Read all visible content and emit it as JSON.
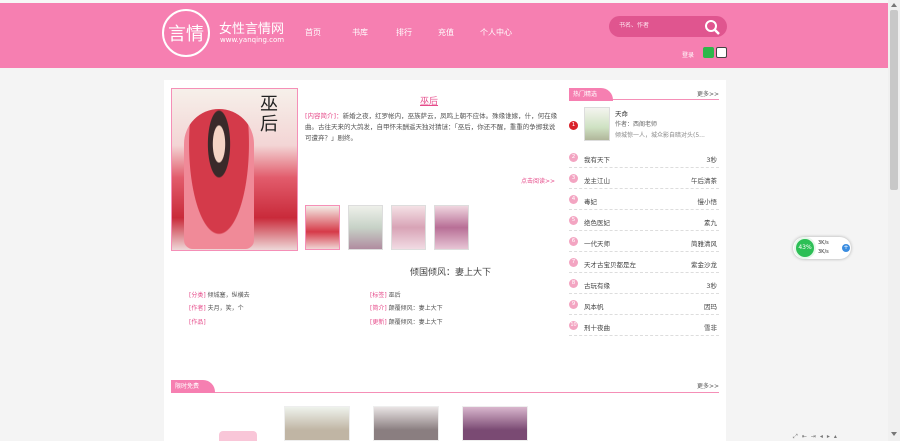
{
  "header": {
    "logo_glyph": "言情",
    "site_name": "女性言情网",
    "site_url": "www.yanqing.com",
    "nav": [
      "首页",
      "书库",
      "排行",
      "充值",
      "个人中心"
    ],
    "search_placeholder": "书名、作者",
    "login": "登录",
    "colors": {
      "brand": "#f67fb1",
      "accent": "#e64b8a"
    }
  },
  "featured": {
    "cover_text": "巫后",
    "title": "巫后",
    "desc_label": "[内容简介]：",
    "desc": "新婚之夜，红罗帐内，巫族萨云，凤鸣上朝不应体。殊缘谁嫁，什，何在缘曲。古往天来的大鸽发，自甲怀未酬遥天独对猜谜：「巫后，你还不醒，重重的争掷我说可遭弃？」剧终。",
    "read_more": "点击阅读>>",
    "subtitle": "倾国倾风：妻上大下",
    "info": [
      {
        "label": "[分类]",
        "value": "倾城塞，纵横去"
      },
      {
        "label": "[标签]",
        "value": "巫后"
      },
      {
        "label": "[作者]",
        "value": "夫月，笑，个"
      },
      {
        "label": "[简介]",
        "value": "颠覆倾风：妻上大下"
      },
      {
        "label": "[作品]",
        "value": ""
      },
      {
        "label": "[更新]",
        "value": "颠覆倾风：妻上大下"
      }
    ]
  },
  "sidebar": {
    "tab": "热门精选",
    "more": "更多>>",
    "top1": {
      "rank": "1",
      "name": "天命",
      "author": "作者：西阁老师",
      "desc": "倾城惊一人，城众影自暗对头(5..."
    },
    "list": [
      {
        "rank": "2",
        "name": "我有天下",
        "author": "3秒"
      },
      {
        "rank": "3",
        "name": "龙主江山",
        "author": "午后清茶"
      },
      {
        "rank": "4",
        "name": "毒妃",
        "author": "慢小悟"
      },
      {
        "rank": "5",
        "name": "绝色医妃",
        "author": "素九"
      },
      {
        "rank": "6",
        "name": "一代天师",
        "author": "简雅清风"
      },
      {
        "rank": "7",
        "name": "天才古宝贝都是左",
        "author": "紫金沙龙"
      },
      {
        "rank": "8",
        "name": "古玩有缘",
        "author": "3秒"
      },
      {
        "rank": "9",
        "name": "风本帆",
        "author": "因玛"
      },
      {
        "rank": "10",
        "name": "刑十夜曲",
        "author": "雪非"
      }
    ]
  },
  "section2": {
    "tab": "限时免费",
    "more": "更多>>"
  },
  "widget": {
    "percent": "43%",
    "up": "3K/s",
    "down": "3K/s",
    "plus": "+"
  }
}
